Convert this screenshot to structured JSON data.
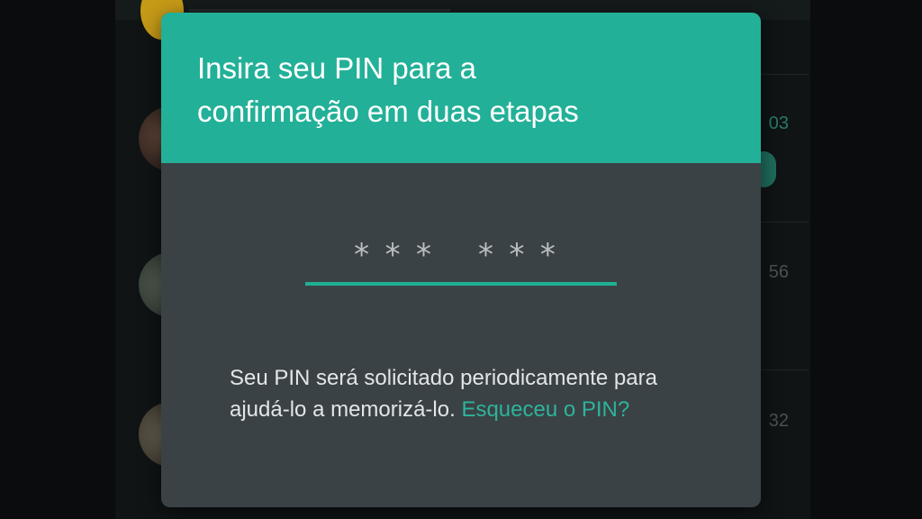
{
  "background": {
    "chat_times": [
      "03",
      "56",
      "32"
    ]
  },
  "dialog": {
    "title": "Insira seu PIN para a\nconfirmação em duas etapas",
    "pin_mask": "*** ***",
    "message_text": "Seu PIN será solicitado periodicamente para ajudá-lo a memorizá-lo.",
    "forgot_link": "Esqueceu o PIN?"
  },
  "colors": {
    "header": "#23b098",
    "dialog_body": "#3a4245",
    "accent": "#1fb094",
    "link": "#2fb39b"
  }
}
